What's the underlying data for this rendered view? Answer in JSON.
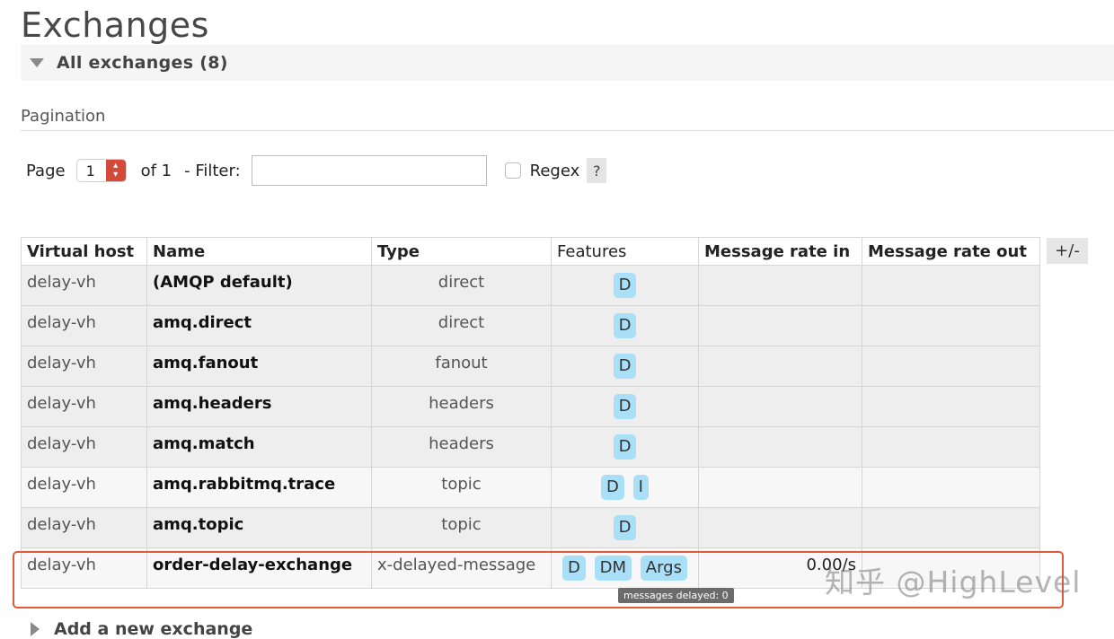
{
  "page": {
    "title": "Exchanges"
  },
  "section": {
    "title": "All exchanges (8)"
  },
  "pagination": {
    "label": "Pagination",
    "page_label": "Page",
    "page_value": "1",
    "of_label": "of 1",
    "filter_label": "- Filter:",
    "filter_value": "",
    "regex_label": "Regex",
    "help_label": "?"
  },
  "table": {
    "columns": [
      "Virtual host",
      "Name",
      "Type",
      "Features",
      "Message rate in",
      "Message rate out"
    ],
    "plus_minus": "+/-",
    "rows": [
      {
        "vhost": "delay-vh",
        "name": "(AMQP default)",
        "type": "direct",
        "features": [
          "D"
        ],
        "rate_in": "",
        "rate_out": ""
      },
      {
        "vhost": "delay-vh",
        "name": "amq.direct",
        "type": "direct",
        "features": [
          "D"
        ],
        "rate_in": "",
        "rate_out": ""
      },
      {
        "vhost": "delay-vh",
        "name": "amq.fanout",
        "type": "fanout",
        "features": [
          "D"
        ],
        "rate_in": "",
        "rate_out": ""
      },
      {
        "vhost": "delay-vh",
        "name": "amq.headers",
        "type": "headers",
        "features": [
          "D"
        ],
        "rate_in": "",
        "rate_out": ""
      },
      {
        "vhost": "delay-vh",
        "name": "amq.match",
        "type": "headers",
        "features": [
          "D"
        ],
        "rate_in": "",
        "rate_out": ""
      },
      {
        "vhost": "delay-vh",
        "name": "amq.rabbitmq.trace",
        "type": "topic",
        "features": [
          "D",
          "I"
        ],
        "rate_in": "",
        "rate_out": ""
      },
      {
        "vhost": "delay-vh",
        "name": "amq.topic",
        "type": "topic",
        "features": [
          "D"
        ],
        "rate_in": "",
        "rate_out": ""
      },
      {
        "vhost": "delay-vh",
        "name": "order-delay-exchange",
        "type": "x-delayed-message",
        "features": [
          "D",
          "DM",
          "Args"
        ],
        "rate_in": "0.00/s",
        "rate_out": ""
      }
    ]
  },
  "tooltip": {
    "text": "messages delayed: 0"
  },
  "watermark": {
    "text": "知乎 @HighLevel"
  },
  "add_section": {
    "title": "Add a new exchange"
  },
  "colors": {
    "badge": "#a9dff7",
    "highlight": "#e05a3a",
    "spinner": "#d44a3a"
  }
}
